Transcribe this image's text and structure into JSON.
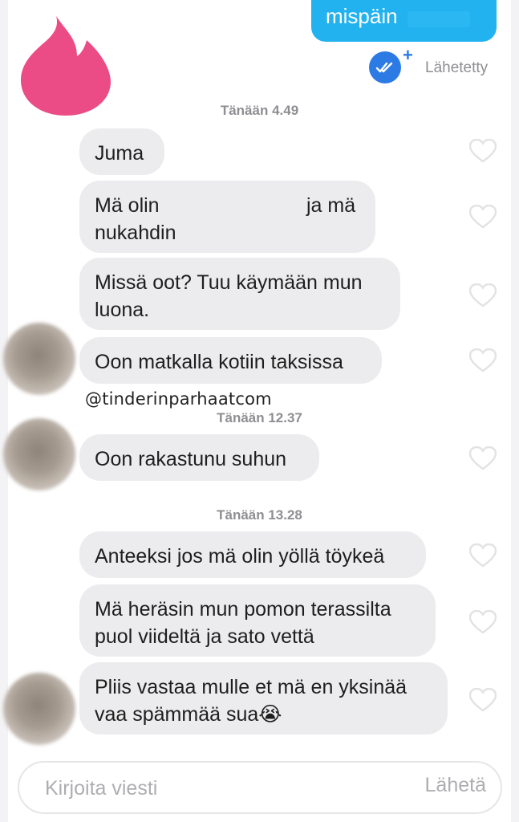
{
  "outgoing": {
    "text": "mispäin",
    "status": "Lähetetty",
    "status_icon": "double-check-icon",
    "plus_icon": "plus-icon"
  },
  "colors": {
    "brand_flame": "#ec4c86",
    "sent_bubble": "#22b2ef",
    "received_bubble": "#ececee",
    "read_badge": "#2c7be5"
  },
  "messages": {
    "ts1": "Tänään 4.49",
    "m1": "Juma",
    "m2_l1": "Mä olin",
    "m2_l1b": "ja mä",
    "m2_l2": "nukahdin",
    "m3": "Missä oot? Tuu käymään mun luona.",
    "m4": "Oon matkalla kotiin taksissa",
    "watermark": "@tinderinparhaatcom",
    "ts2": "Tänään 12.37",
    "m5": "Oon rakastunu suhun",
    "ts3": "Tänään 13.28",
    "m6": "Anteeksi jos mä olin yöllä töykeä",
    "m7": "Mä heräsin mun pomon terassilta puol viideltä ja sato vettä",
    "m8": "Pliis vastaa mulle et mä en yksinää vaa spämmää sua",
    "m8_emoji": "😭"
  },
  "composer": {
    "placeholder": "Kirjoita viesti",
    "send": "Lähetä"
  }
}
